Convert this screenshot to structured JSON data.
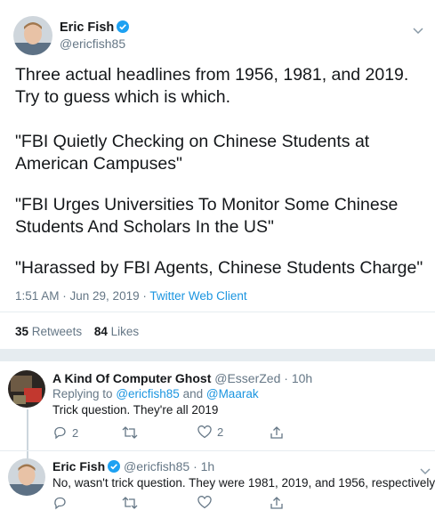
{
  "tweet": {
    "name": "Eric Fish",
    "handle": "@ericfish85",
    "intro": "Three actual headlines from 1956, 1981, and 2019. Try to guess which is which.",
    "headline1": "\"FBI Quietly Checking on Chinese Students at American Campuses\"",
    "headline2": "\"FBI Urges Universities To Monitor Some Chinese Students And Scholars In the US\"",
    "headline3": "\"Harassed by FBI Agents, Chinese Students Charge\"",
    "time": "1:51 AM · Jun 29, 2019",
    "client": "Twitter Web Client",
    "retweets_count": "35",
    "retweets_label": "Retweets",
    "likes_count": "84",
    "likes_label": "Likes"
  },
  "reply1": {
    "name": "A Kind Of Computer Ghost",
    "handle": "@EsserZed",
    "time": "· 10h",
    "replying_prefix": "Replying to",
    "mention1": "@ericfish85",
    "and": "and",
    "mention2": "@Maarak",
    "text": "Trick question. They're all 2019",
    "reply_count": "2",
    "like_count": "2"
  },
  "reply2": {
    "name": "Eric Fish",
    "handle": "@ericfish85",
    "time": "· 1h",
    "text": "No, wasn't trick question. They were 1981, 2019, and 1956, respectively"
  },
  "colors": {
    "accent": "#1b95e0",
    "verified": "#1da1f2",
    "muted": "#657786"
  }
}
